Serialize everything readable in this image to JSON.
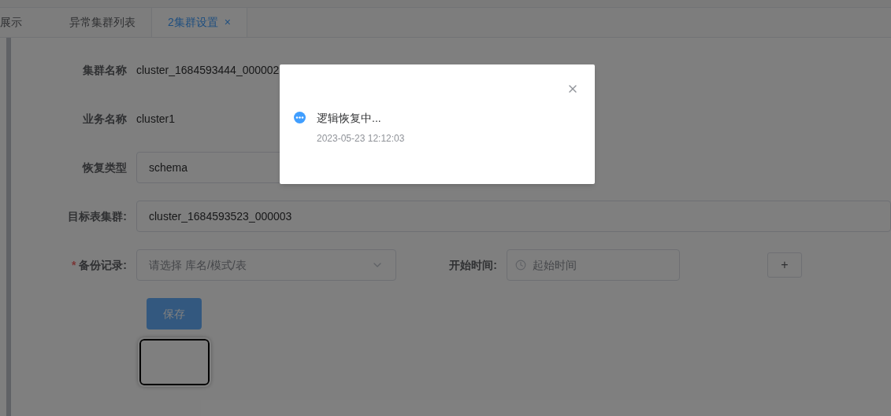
{
  "tabs": [
    {
      "label": "展示",
      "selected": false,
      "closable": false
    },
    {
      "label": "异常集群列表",
      "selected": false,
      "closable": false
    },
    {
      "label": "2集群设置",
      "selected": true,
      "closable": true,
      "close": "×"
    }
  ],
  "form": {
    "rows": [
      {
        "kind": "text",
        "label": "集群名称",
        "value": "cluster_1684593444_000002"
      },
      {
        "kind": "text",
        "label": "业务名称",
        "value": "cluster1"
      },
      {
        "kind": "input",
        "label": "恢复类型",
        "value": "schema"
      },
      {
        "kind": "input",
        "label": "目标表集群:",
        "value": "cluster_1684593523_000003"
      }
    ],
    "backup": {
      "label": "备份记录:",
      "required": true,
      "required_mark": "*",
      "placeholder": "请选择 库名/模式/表"
    },
    "start_time": {
      "label": "开始时间:",
      "placeholder": "起始时间"
    },
    "add_button": "+",
    "save_button": "保存"
  },
  "notification": {
    "title": "逻辑恢复中...",
    "time": "2023-05-23 12:12:03"
  }
}
